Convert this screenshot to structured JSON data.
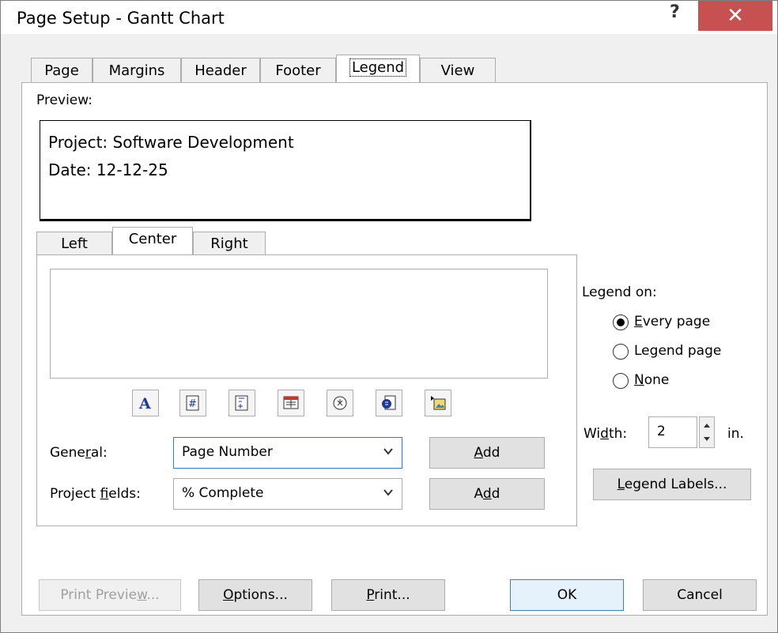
{
  "window": {
    "title": "Page Setup - Gantt Chart",
    "help": "?",
    "close": "✕"
  },
  "tabs": [
    "Page",
    "Margins",
    "Header",
    "Footer",
    "Legend",
    "View"
  ],
  "preview": {
    "label": "Preview:",
    "line1": "Project: Software Development",
    "line2": "Date: 12-12-25"
  },
  "inner_tabs": [
    "Left",
    "Center",
    "Right"
  ],
  "general": {
    "label_pre": "Gene",
    "label_u": "r",
    "label_post": "al:",
    "value": "Page Number",
    "add_pre": "",
    "add_u": "A",
    "add_post": "dd"
  },
  "fields": {
    "label_pre": "Project ",
    "label_u": "f",
    "label_post": "ields:",
    "value": "% Complete",
    "add_pre": "A",
    "add_u": "d",
    "add_post": "d"
  },
  "legend_on": {
    "label": "Legend on:",
    "options": [
      {
        "pre": "",
        "u": "E",
        "post": "very page",
        "selected": true
      },
      {
        "pre": "Le",
        "u": "g",
        "post": "end page",
        "selected": false
      },
      {
        "pre": "",
        "u": "N",
        "post": "one",
        "selected": false
      }
    ]
  },
  "width": {
    "label_pre": "Wi",
    "label_u": "d",
    "label_post": "th:",
    "value": "2",
    "unit": "in."
  },
  "legend_labels": {
    "pre": "",
    "u": "L",
    "post": "egend Labels..."
  },
  "footer_buttons": {
    "print_preview": {
      "pre": "Print Previe",
      "u": "w",
      "post": "..."
    },
    "options": {
      "pre": "",
      "u": "O",
      "post": "ptions..."
    },
    "print": {
      "pre": "",
      "u": "P",
      "post": "rint..."
    },
    "ok": "OK",
    "cancel": "Cancel"
  },
  "icons": [
    "font-icon",
    "page-number-icon",
    "total-pages-icon",
    "date-icon",
    "time-icon",
    "file-name-icon",
    "picture-icon"
  ],
  "colors": {
    "close_bg": "#c75050",
    "focus_border": "#2f7bd6",
    "default_button_border": "#3c7fb1"
  }
}
